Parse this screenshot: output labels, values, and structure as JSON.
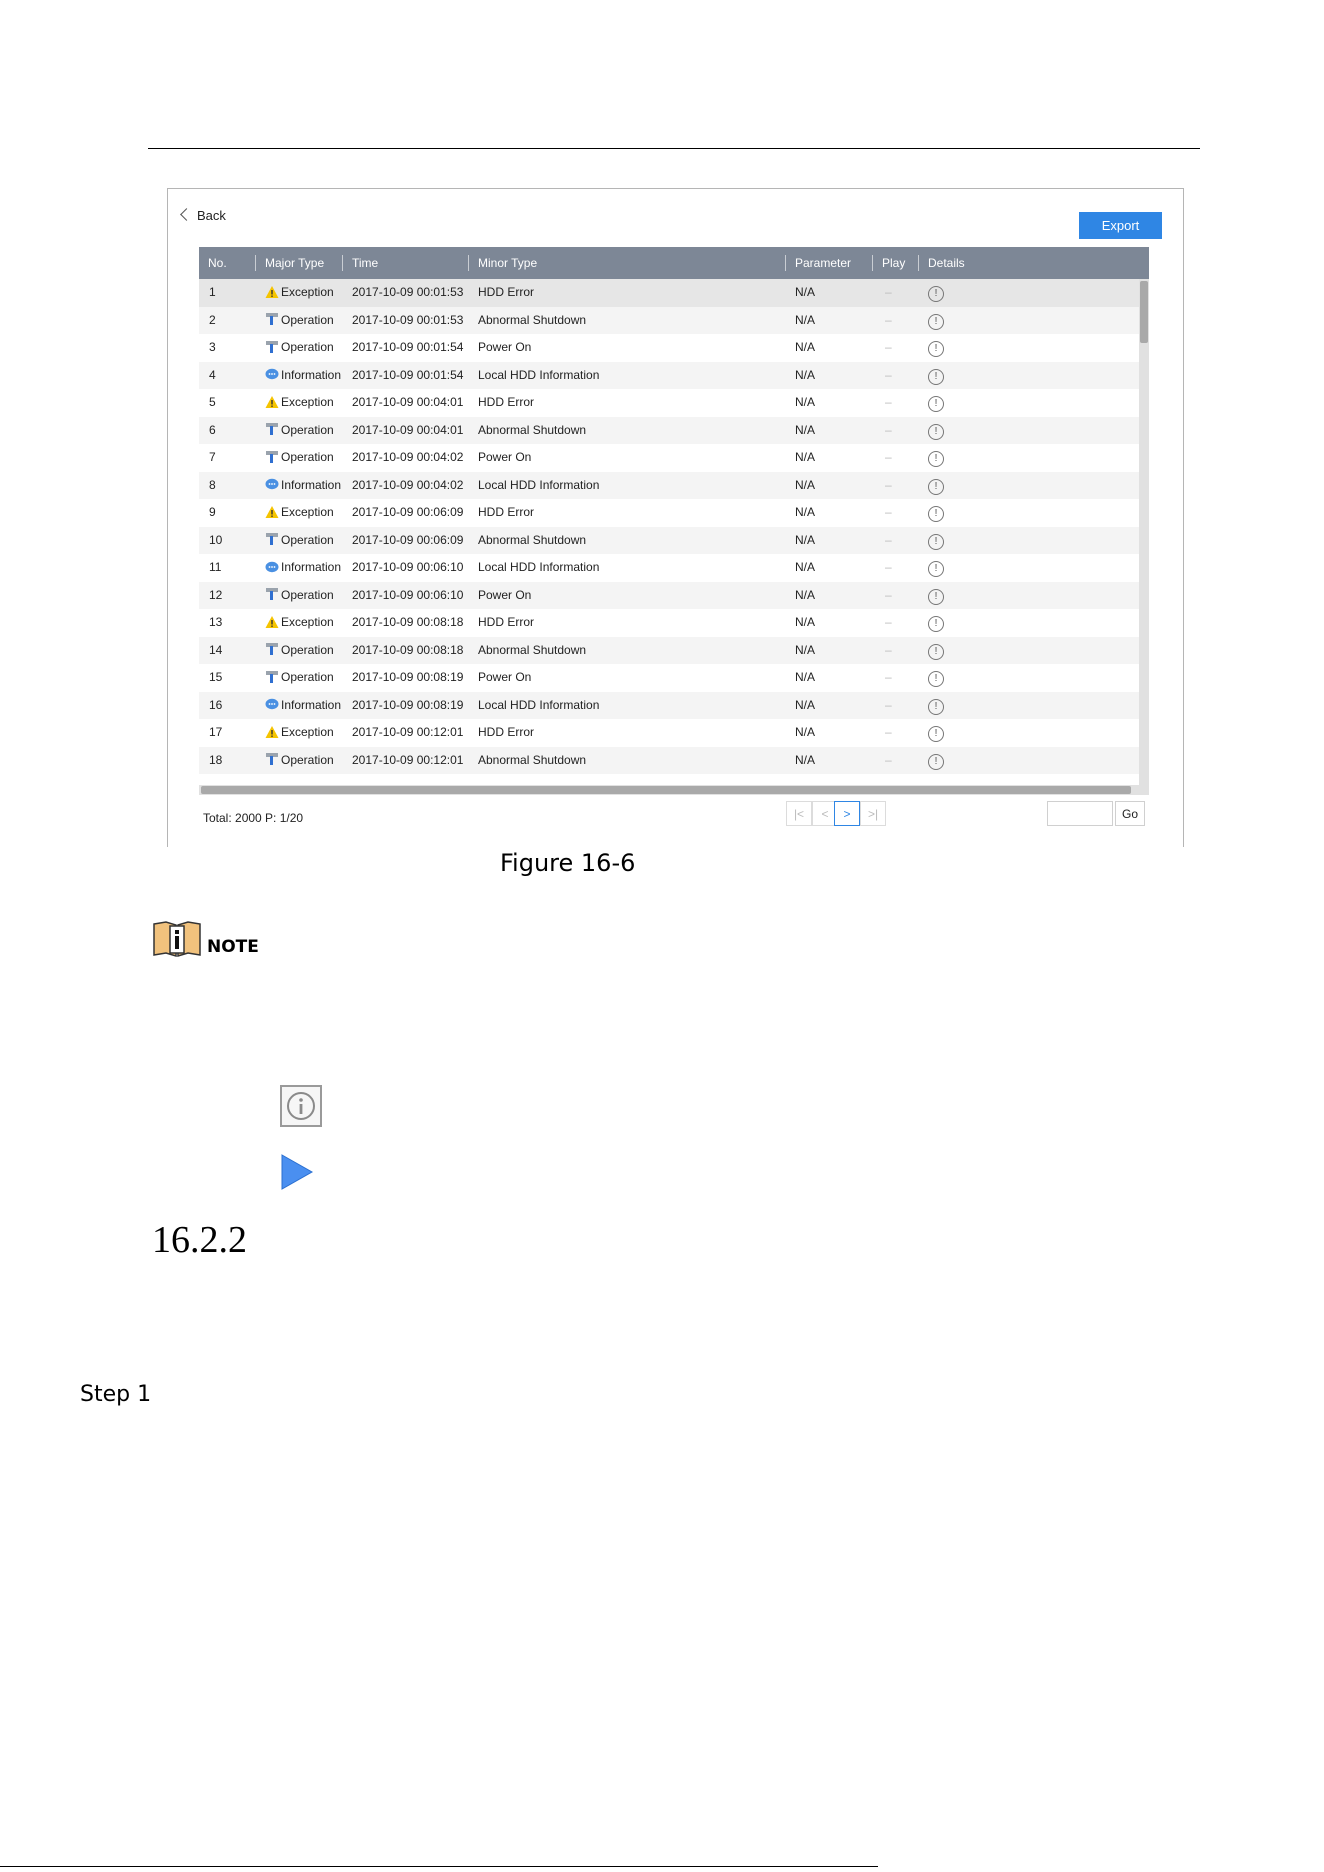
{
  "screen": {
    "back_label": "Back",
    "export_label": "Export",
    "columns": [
      "No.",
      "Major Type",
      "Time",
      "Minor Type",
      "Parameter",
      "Play",
      "Details"
    ],
    "rows": [
      {
        "no": "1",
        "major": "Exception",
        "icon": "warning-icon",
        "time": "2017-10-09 00:01:53",
        "minor": "HDD Error",
        "param": "N/A",
        "play": "–"
      },
      {
        "no": "2",
        "major": "Operation",
        "icon": "operation-icon",
        "time": "2017-10-09 00:01:53",
        "minor": "Abnormal Shutdown",
        "param": "N/A",
        "play": "–"
      },
      {
        "no": "3",
        "major": "Operation",
        "icon": "operation-icon",
        "time": "2017-10-09 00:01:54",
        "minor": "Power On",
        "param": "N/A",
        "play": "–"
      },
      {
        "no": "4",
        "major": "Information",
        "icon": "information-icon",
        "time": "2017-10-09 00:01:54",
        "minor": "Local HDD Information",
        "param": "N/A",
        "play": "–"
      },
      {
        "no": "5",
        "major": "Exception",
        "icon": "warning-icon",
        "time": "2017-10-09 00:04:01",
        "minor": "HDD Error",
        "param": "N/A",
        "play": "–"
      },
      {
        "no": "6",
        "major": "Operation",
        "icon": "operation-icon",
        "time": "2017-10-09 00:04:01",
        "minor": "Abnormal Shutdown",
        "param": "N/A",
        "play": "–"
      },
      {
        "no": "7",
        "major": "Operation",
        "icon": "operation-icon",
        "time": "2017-10-09 00:04:02",
        "minor": "Power On",
        "param": "N/A",
        "play": "–"
      },
      {
        "no": "8",
        "major": "Information",
        "icon": "information-icon",
        "time": "2017-10-09 00:04:02",
        "minor": "Local HDD Information",
        "param": "N/A",
        "play": "–"
      },
      {
        "no": "9",
        "major": "Exception",
        "icon": "warning-icon",
        "time": "2017-10-09 00:06:09",
        "minor": "HDD Error",
        "param": "N/A",
        "play": "–"
      },
      {
        "no": "10",
        "major": "Operation",
        "icon": "operation-icon",
        "time": "2017-10-09 00:06:09",
        "minor": "Abnormal Shutdown",
        "param": "N/A",
        "play": "–"
      },
      {
        "no": "11",
        "major": "Information",
        "icon": "information-icon",
        "time": "2017-10-09 00:06:10",
        "minor": "Local HDD Information",
        "param": "N/A",
        "play": "–"
      },
      {
        "no": "12",
        "major": "Operation",
        "icon": "operation-icon",
        "time": "2017-10-09 00:06:10",
        "minor": "Power On",
        "param": "N/A",
        "play": "–"
      },
      {
        "no": "13",
        "major": "Exception",
        "icon": "warning-icon",
        "time": "2017-10-09 00:08:18",
        "minor": "HDD Error",
        "param": "N/A",
        "play": "–"
      },
      {
        "no": "14",
        "major": "Operation",
        "icon": "operation-icon",
        "time": "2017-10-09 00:08:18",
        "minor": "Abnormal Shutdown",
        "param": "N/A",
        "play": "–"
      },
      {
        "no": "15",
        "major": "Operation",
        "icon": "operation-icon",
        "time": "2017-10-09 00:08:19",
        "minor": "Power On",
        "param": "N/A",
        "play": "–"
      },
      {
        "no": "16",
        "major": "Information",
        "icon": "information-icon",
        "time": "2017-10-09 00:08:19",
        "minor": "Local HDD Information",
        "param": "N/A",
        "play": "–"
      },
      {
        "no": "17",
        "major": "Exception",
        "icon": "warning-icon",
        "time": "2017-10-09 00:12:01",
        "minor": "HDD Error",
        "param": "N/A",
        "play": "–"
      },
      {
        "no": "18",
        "major": "Operation",
        "icon": "operation-icon",
        "time": "2017-10-09 00:12:01",
        "minor": "Abnormal Shutdown",
        "param": "N/A",
        "play": "–"
      }
    ],
    "total_label": "Total: 2000  P: 1/20",
    "go_label": "Go",
    "colors": {
      "header_bg": "#7d8796",
      "accent": "#2f86e4",
      "warning": "#f5c400",
      "information": "#4a90e2"
    }
  },
  "document": {
    "caption": "Figure 16-6",
    "note_label": "NOTE",
    "section_number": "16.2.2",
    "step_label": "Step 1"
  }
}
